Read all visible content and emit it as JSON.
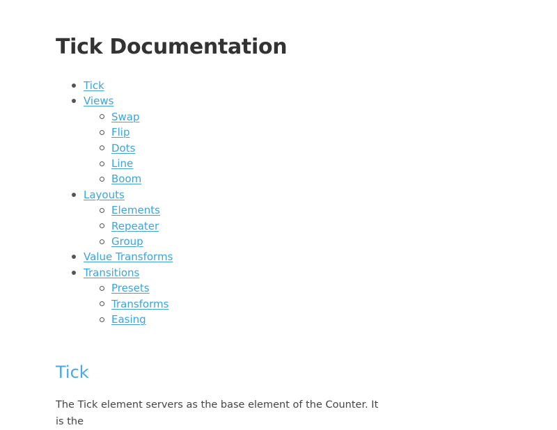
{
  "title": "Tick Documentation",
  "toc": [
    {
      "label": "Tick",
      "children": []
    },
    {
      "label": "Views",
      "children": [
        "Swap",
        "Flip",
        "Dots",
        "Line",
        "Boom"
      ]
    },
    {
      "label": "Layouts",
      "children": [
        "Elements",
        "Repeater",
        "Group"
      ]
    },
    {
      "label": "Value Transforms",
      "children": []
    },
    {
      "label": "Transitions",
      "children": [
        "Presets",
        "Transforms",
        "Easing"
      ]
    }
  ],
  "section": {
    "heading": "Tick",
    "body": "The Tick element servers as the base element of the Counter. It is the"
  },
  "colors": {
    "link": "#3aa4e0",
    "heading": "#4aa8de",
    "text": "#333333"
  }
}
